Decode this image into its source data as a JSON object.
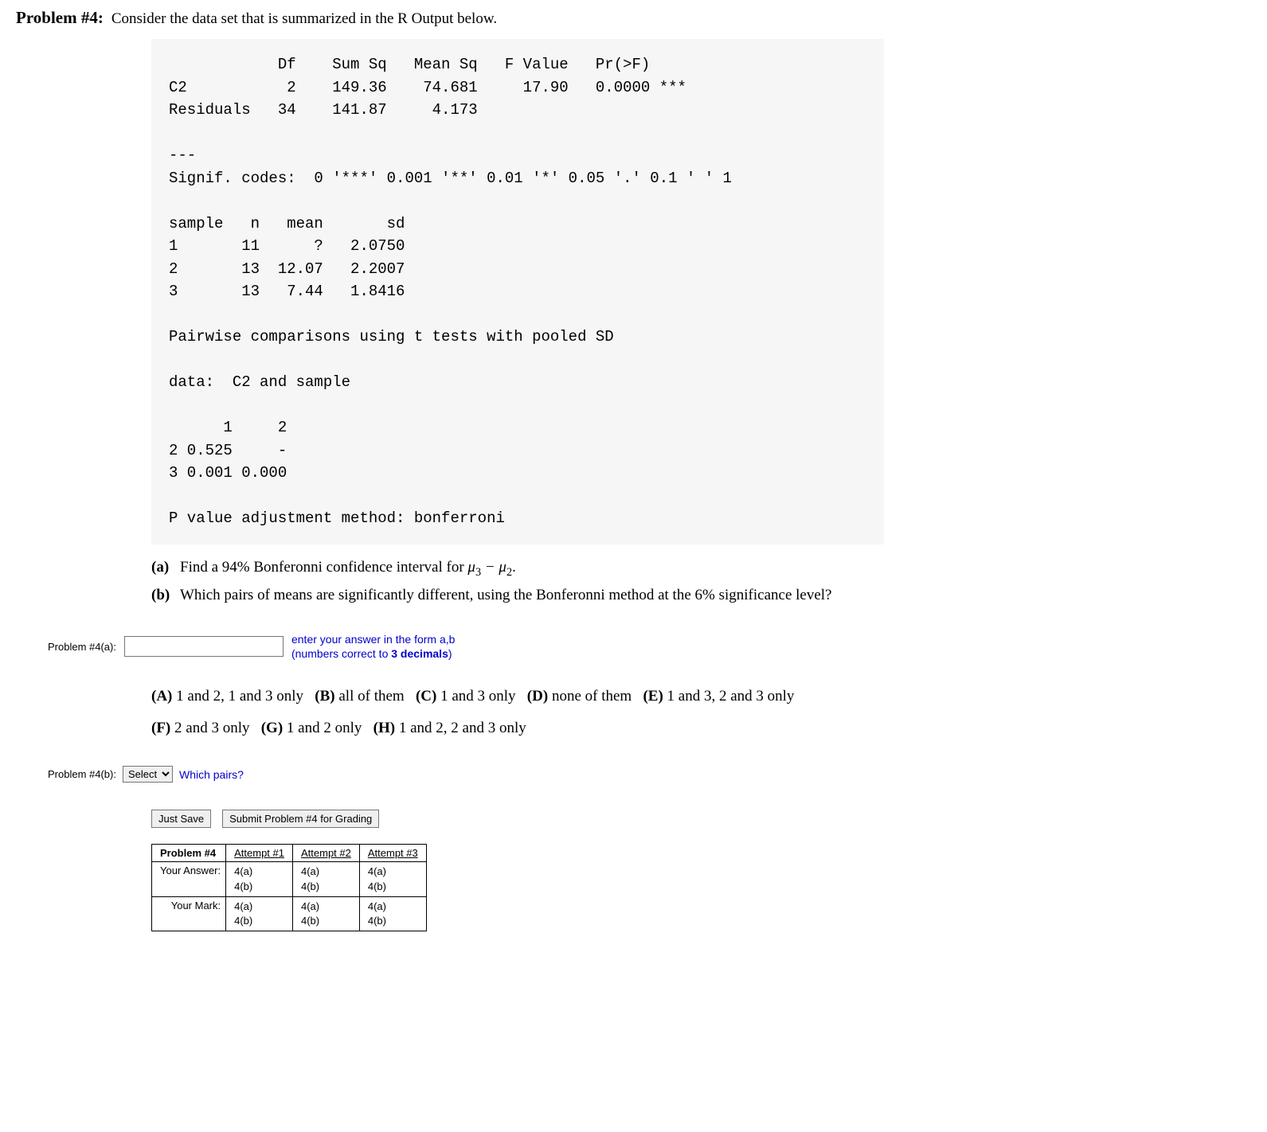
{
  "heading": {
    "label": "Problem #4:",
    "text": "Consider the data set that is summarized in the R Output below."
  },
  "r_output": {
    "anova": {
      "cols": [
        "Df",
        "Sum Sq",
        "Mean Sq",
        "F Value",
        "Pr(>F)"
      ],
      "rows": [
        {
          "name": "C2",
          "Df": "2",
          "SumSq": "149.36",
          "MeanSq": "74.681",
          "F": "17.90",
          "Pr": "0.0000 ***"
        },
        {
          "name": "Residuals",
          "Df": "34",
          "SumSq": "141.87",
          "MeanSq": "4.173",
          "F": "",
          "Pr": ""
        }
      ]
    },
    "signif_sep": "---",
    "signif_line": "Signif. codes:  0 '***' 0.001 '**' 0.01 '*' 0.05 '.' 0.1 ' ' 1",
    "samples": {
      "cols": [
        "sample",
        "n",
        "mean",
        "sd"
      ],
      "rows": [
        {
          "sample": "1",
          "n": "11",
          "mean": "?",
          "sd": "2.0750"
        },
        {
          "sample": "2",
          "n": "13",
          "mean": "12.07",
          "sd": "2.2007"
        },
        {
          "sample": "3",
          "n": "13",
          "mean": "7.44",
          "sd": "1.8416"
        }
      ]
    },
    "pairwise_title": "Pairwise comparisons using t tests with pooled SD",
    "data_line": "data:  C2 and sample",
    "pvalue_matrix": {
      "cols": [
        "1",
        "2"
      ],
      "rows": [
        {
          "r": "2",
          "v": [
            "0.525",
            "-"
          ]
        },
        {
          "r": "3",
          "v": [
            "0.001",
            "0.000"
          ]
        }
      ]
    },
    "adjust_line": "P value adjustment method: bonferroni"
  },
  "parts": {
    "a_label": "(a)",
    "a_text_pre": "Find a 94% Bonferonni confidence interval for ",
    "a_mu": "μ3 − μ2",
    "a_text_post": ".",
    "b_label": "(b)",
    "b_text": "Which pairs of means are significantly different, using the Bonferonni method at the 6% significance level?"
  },
  "answer_a": {
    "label": "Problem #4(a):",
    "placeholder": "",
    "hint_line1": "enter your answer in the form a,b",
    "hint_line2_pre": "(numbers correct to ",
    "hint_line2_bold": "3 decimals",
    "hint_line2_post": ")"
  },
  "choices": [
    {
      "k": "(A)",
      "t": "1 and 2, 1 and 3 only"
    },
    {
      "k": "(B)",
      "t": "all of them"
    },
    {
      "k": "(C)",
      "t": "1 and 3 only"
    },
    {
      "k": "(D)",
      "t": "none of them"
    },
    {
      "k": "(E)",
      "t": "1 and 3, 2 and 3 only"
    },
    {
      "k": "(F)",
      "t": "2 and 3 only"
    },
    {
      "k": "(G)",
      "t": "1 and 2 only"
    },
    {
      "k": "(H)",
      "t": "1 and 2, 2 and 3 only"
    }
  ],
  "answer_b": {
    "label": "Problem #4(b):",
    "select_value": "Select",
    "which": "Which pairs?"
  },
  "buttons": {
    "save": "Just Save",
    "submit": "Submit Problem #4 for Grading"
  },
  "attempts": {
    "header": [
      "Problem #4",
      "Attempt #1",
      "Attempt #2",
      "Attempt #3"
    ],
    "rows": [
      {
        "label": "Your Answer:",
        "cells": [
          "4(a)\n4(b)",
          "4(a)\n4(b)",
          "4(a)\n4(b)"
        ]
      },
      {
        "label": "Your Mark:",
        "cells": [
          "4(a)\n4(b)",
          "4(a)\n4(b)",
          "4(a)\n4(b)"
        ]
      }
    ]
  }
}
